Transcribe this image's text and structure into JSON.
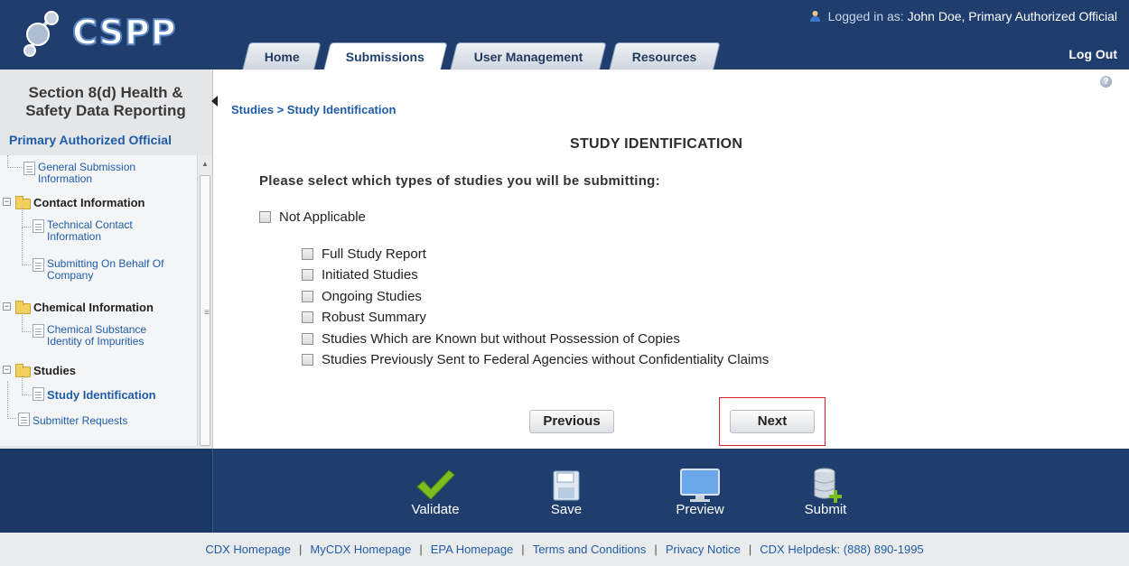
{
  "header": {
    "logo_text": "CSPP",
    "logged_in_label": "Logged in as:",
    "user_name": "John Doe, Primary Authorized Official",
    "tabs": [
      "Home",
      "Submissions",
      "User Management",
      "Resources"
    ],
    "active_tab": "Submissions",
    "logout_label": "Log Out"
  },
  "sidebar": {
    "title_line1": "Section 8(d) Health &",
    "title_line2": "Safety Data Reporting",
    "role": "Primary Authorized Official",
    "tree": {
      "general_line1": "General Submission",
      "general_line2": "Information",
      "contact_folder": "Contact Information",
      "technical_line1": "Technical Contact",
      "technical_line2": "Information",
      "behalf_line1": "Submitting On Behalf Of",
      "behalf_line2": "Company",
      "chemical_folder": "Chemical Information",
      "substance_line1": "Chemical Substance",
      "substance_line2": "Identity of Impurities",
      "studies_folder": "Studies",
      "study_identification": "Study Identification",
      "submitter_requests": "Submitter Requests"
    }
  },
  "main": {
    "breadcrumb": "Studies > Study Identification",
    "title": "STUDY IDENTIFICATION",
    "question": "Please select which types of studies you will be submitting:",
    "not_applicable": "Not Applicable",
    "options": [
      "Full Study Report",
      "Initiated Studies",
      "Ongoing Studies",
      "Robust Summary",
      "Studies Which are Known but without Possession of Copies",
      "Studies Previously Sent to Federal Agencies without Confidentiality Claims"
    ],
    "previous_label": "Previous",
    "next_label": "Next"
  },
  "actions": {
    "validate": "Validate",
    "save": "Save",
    "preview": "Preview",
    "submit": "Submit"
  },
  "footer": {
    "links": [
      "CDX Homepage",
      "MyCDX Homepage",
      "EPA Homepage",
      "Terms and Conditions",
      "Privacy Notice",
      "CDX Helpdesk: (888) 890-1995"
    ]
  },
  "colors": {
    "header_bg": "#1f3e6e",
    "link_blue": "#1f5ca8",
    "highlight_border": "#d6262b",
    "validate_check": "#7bbf1f"
  }
}
